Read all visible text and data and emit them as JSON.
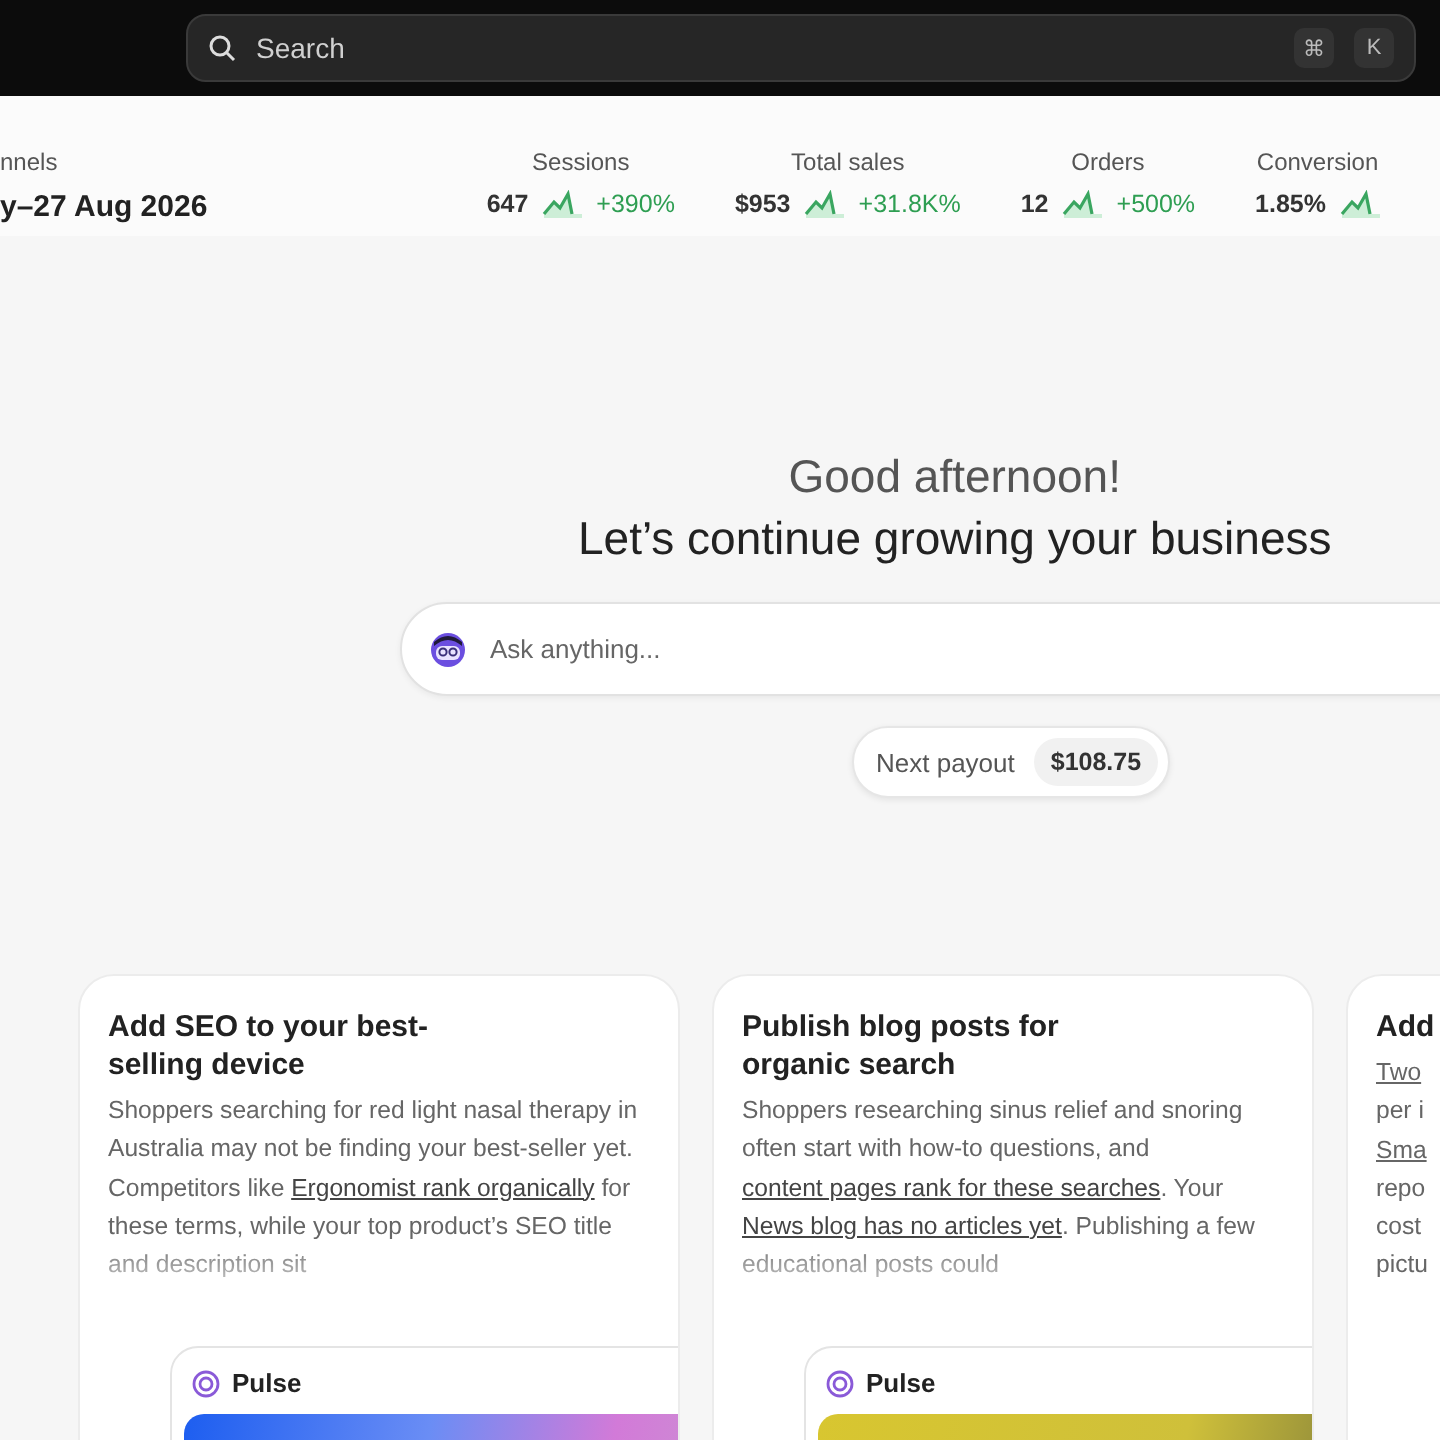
{
  "top_bar": {
    "search": {
      "placeholder": "Search",
      "shortcut": [
        "⌘",
        "K"
      ]
    }
  },
  "summary": {
    "channel_label": "nnels",
    "date_range": "y–27 Aug 2026",
    "metrics": [
      {
        "label": "Sessions",
        "value": "647",
        "change": "+390%"
      },
      {
        "label": "Total sales",
        "value": "$953",
        "change": "+31.8K%"
      },
      {
        "label": "Orders",
        "value": "12",
        "change": "+500%"
      },
      {
        "label": "Conversion",
        "value": "1.85%"
      }
    ]
  },
  "greeting": {
    "title": "Good afternoon!",
    "subtitle": "Let’s continue growing your business"
  },
  "assistant": {
    "placeholder": "Ask anything..."
  },
  "payout": {
    "label": "Next payout",
    "amount": "$108.75"
  },
  "cards": [
    {
      "title": "Add SEO to your best-selling device",
      "body": [
        {
          "text": "Shoppers searching for red light nasal therapy in Australia may not be finding your best-seller yet. Competitors like ",
          "link": false
        },
        {
          "text": "Ergonomist rank organically",
          "link": true
        },
        {
          "text": " for these terms, while your top product’s SEO title and description sit",
          "link": false
        }
      ],
      "preview": {
        "title": "Pulse"
      }
    },
    {
      "title": "Publish blog posts for organic search",
      "body": [
        {
          "text": "Shoppers researching sinus relief and snoring often start with how-to questions, and ",
          "link": false
        },
        {
          "text": "content pages rank for these searches",
          "link": true
        },
        {
          "text": ". Your ",
          "link": false
        },
        {
          "text": "News blog has no articles yet",
          "link": true
        },
        {
          "text": ". Publishing a few educational posts could",
          "link": false
        }
      ],
      "preview": {
        "title": "Pulse"
      }
    },
    {
      "title": "Add",
      "lines": [
        {
          "text": "Two",
          "link": true
        },
        {
          "text": "per i",
          "link": false
        },
        {
          "text": "Sma",
          "link": true
        },
        {
          "text": "repo",
          "link": false
        },
        {
          "text": "cost",
          "link": false
        },
        {
          "text": "pictu",
          "link": false
        }
      ]
    }
  ]
}
